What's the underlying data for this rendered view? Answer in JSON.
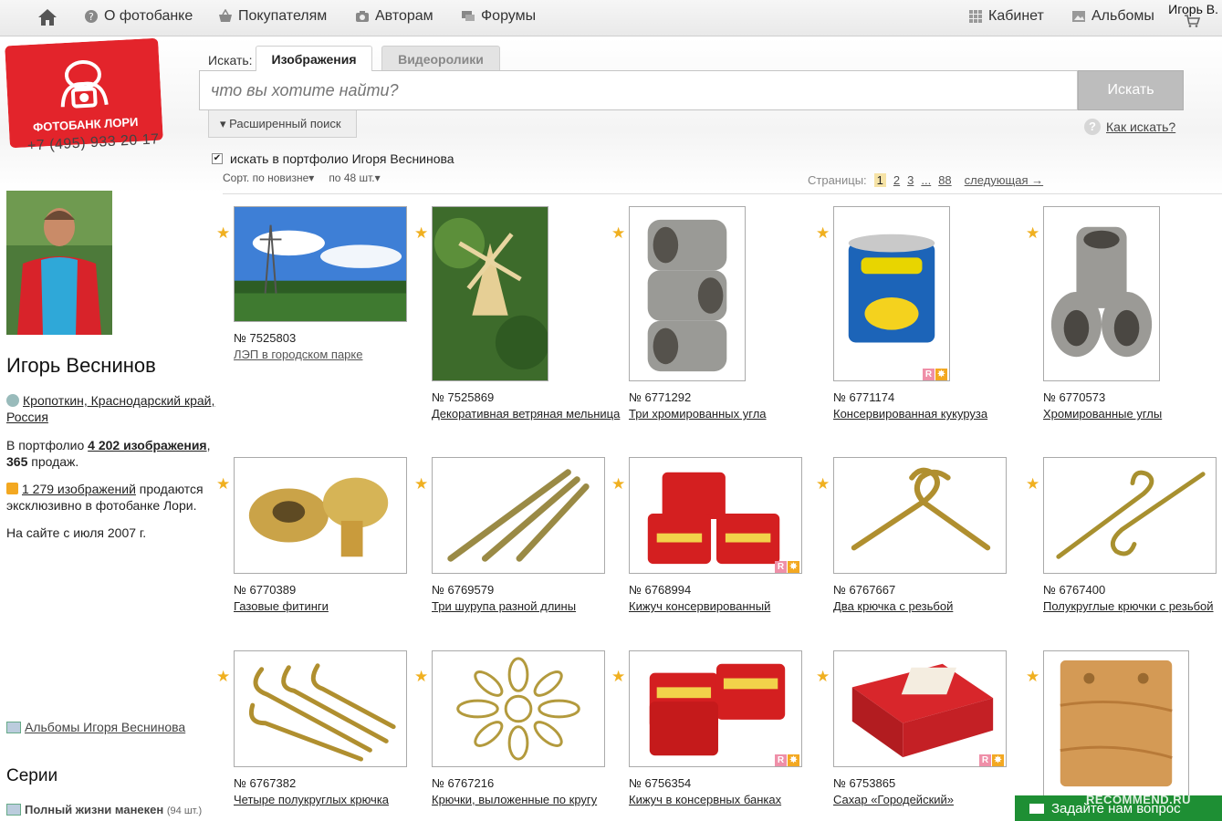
{
  "topbar": {
    "items": [
      {
        "label": "О фотобанке",
        "icon": "question-icon"
      },
      {
        "label": "Покупателям",
        "icon": "basket-icon"
      },
      {
        "label": "Авторам",
        "icon": "camera-icon"
      },
      {
        "label": "Форумы",
        "icon": "chat-icon"
      }
    ],
    "right": [
      {
        "label": "Кабинет",
        "icon": "grid-icon"
      },
      {
        "label": "Альбомы",
        "icon": "album-icon"
      }
    ],
    "user": "Игорь В."
  },
  "logo": {
    "text": "ФОТОБАНК ЛОРИ",
    "color": "#e3242b"
  },
  "phone": "+7 (495) 933 20 17",
  "search": {
    "label": "Искать:",
    "tabs": [
      "Изображения",
      "Видеоролики"
    ],
    "placeholder": "что вы хотите найти?",
    "button": "Искать",
    "advanced": "Расширенный поиск",
    "howto": "Как искать?",
    "in_portfolio": "искать в портфолио Игоря Веснинова"
  },
  "sort": {
    "by": "Сорт. по новизне",
    "per_page": "по 48 шт."
  },
  "pagination": {
    "label": "Страницы:",
    "pages": [
      "1",
      "2",
      "3",
      "...",
      "88"
    ],
    "current": "1",
    "next": "следующая →"
  },
  "author": {
    "name": "Игорь Веснинов",
    "location": "Кропоткин, Краснодарский край, Россия",
    "portfolio_prefix": "В портфолио",
    "portfolio_count": "4 202 изображения",
    "sales": "365",
    "sales_suffix": "продаж.",
    "exclusive_count": "1 279 изображений",
    "exclusive_text": "продаются эксклюзивно в фотобанке Лори.",
    "since": "На сайте с июля 2007 г.",
    "albums": "Альбомы Игоря Веснинова"
  },
  "series": {
    "heading": "Серии",
    "items": [
      {
        "name": "Полный жизни манекен",
        "count": "(94 шт.)"
      }
    ]
  },
  "photos": [
    {
      "id": "№ 7525803",
      "title": "ЛЭП в городском парке"
    },
    {
      "id": "№ 7525869",
      "title": "Декоративная ветряная мельница"
    },
    {
      "id": "№ 6771292",
      "title": "Три хромированных угла"
    },
    {
      "id": "№ 6771174",
      "title": "Консервированная кукуруза",
      "badge": true
    },
    {
      "id": "№ 6770573",
      "title": "Хромированные углы"
    },
    {
      "id": "№ 6770389",
      "title": "Газовые фитинги"
    },
    {
      "id": "№ 6769579",
      "title": "Три шурупа разной длины"
    },
    {
      "id": "№ 6768994",
      "title": "Кижуч консервированный",
      "badge": true
    },
    {
      "id": "№ 6767667",
      "title": "Два крючка с резьбой"
    },
    {
      "id": "№ 6767400",
      "title": "Полукруглые крючки с резьбой"
    },
    {
      "id": "№ 6767382",
      "title": "Четыре полукруглых крючка"
    },
    {
      "id": "№ 6767216",
      "title": "Крючки, выложенные по кругу"
    },
    {
      "id": "№ 6756354",
      "title": "Кижуч в консервных банках",
      "badge": true
    },
    {
      "id": "№ 6753865",
      "title": "Сахар «Городейский»",
      "badge": true
    },
    {
      "id": "",
      "title": ""
    }
  ],
  "feedback": "Задайте нам вопрос",
  "watermark": "RECOMMEND.RU"
}
